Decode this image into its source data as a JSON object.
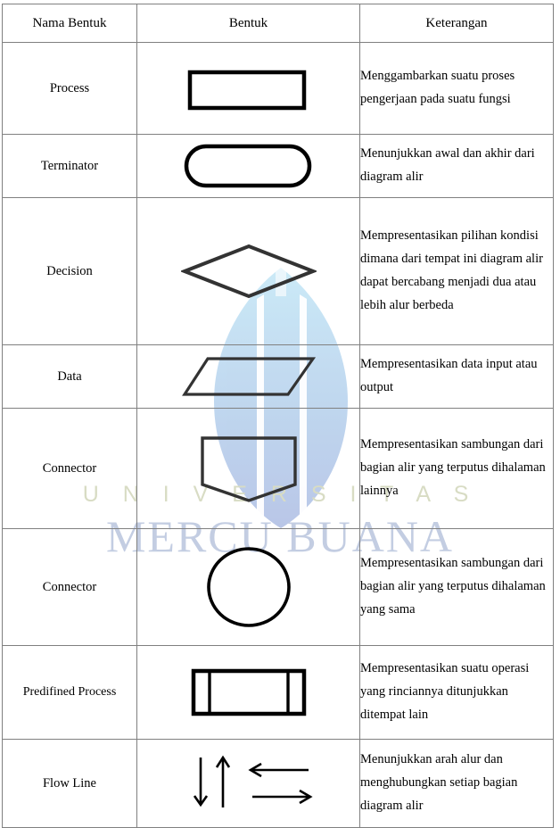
{
  "document": {
    "type": "flowchart-symbol-reference-table",
    "language": "id"
  },
  "watermark": {
    "line1": "U N I V E R S I T A S",
    "line2": "MERCU BUANA",
    "logo_name": "mercu-buana-flame-logo",
    "colors": {
      "flame_light": "#b9e4f5",
      "flame_dark": "#b9c7e6",
      "text_line1": "#d8dcc4",
      "text_line2": "#c3cde2"
    }
  },
  "table": {
    "headers": [
      "Nama Bentuk",
      "Bentuk",
      "Keterangan"
    ],
    "border_color": "#808080",
    "rows": [
      {
        "name": "Process",
        "shape": "rectangle",
        "description": "Menggambarkan suatu proses pengerjaan pada suatu fungsi"
      },
      {
        "name": "Terminator",
        "shape": "stadium",
        "description": "Menunjukkan awal dan akhir dari diagram alir"
      },
      {
        "name": "Decision",
        "shape": "diamond",
        "description": "Mempresentasikan pilihan kondisi dimana dari tempat ini diagram alir dapat bercabang menjadi dua atau lebih alur berbeda"
      },
      {
        "name": "Data",
        "shape": "parallelogram",
        "description": "Mempresentasikan data input atau output"
      },
      {
        "name": "Connector",
        "shape": "pentagon-down",
        "description": "Mempresentasikan sambungan dari bagian alir yang terputus dihalaman lainnya"
      },
      {
        "name": "Connector",
        "shape": "circle",
        "description": "Mempresentasikan sambungan dari bagian alir yang terputus dihalaman yang sama"
      },
      {
        "name": "Predifined Process",
        "shape": "predefined-process",
        "description": "Mempresentasikan suatu operasi yang rinciannya ditunjukkan ditempat lain"
      },
      {
        "name": "Flow Line",
        "shape": "arrows",
        "description": "Menunjukkan arah alur dan menghubungkan setiap bagian diagram alir"
      }
    ]
  }
}
